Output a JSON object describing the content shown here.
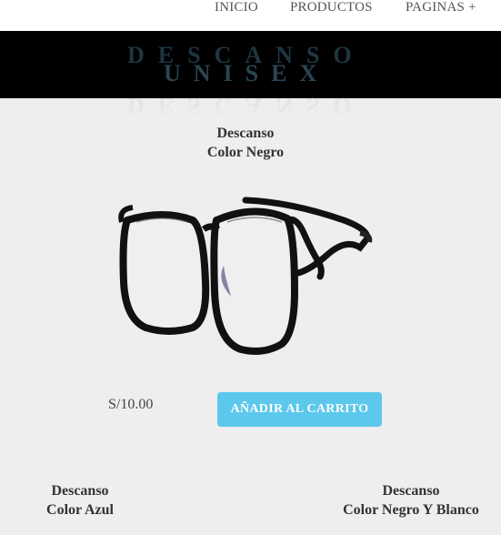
{
  "nav": {
    "items": [
      "INICIO",
      "PRODUCTOS",
      "PAGINAS +"
    ]
  },
  "banner": {
    "title": "DESCANSO",
    "subtitle": "UNISEX"
  },
  "featured_product": {
    "name_line1": "Descanso",
    "name_line2": "Color Negro",
    "price": "S/10.00",
    "add_to_cart_label": "AÑADIR AL CARRITO"
  },
  "more_products": [
    {
      "name_line1": "Descanso",
      "name_line2": "Color Azul"
    },
    {
      "name_line1": "Descanso",
      "name_line2": "Color Negro Y Blanco"
    }
  ],
  "colors": {
    "banner_bg": "#000000",
    "page_bg": "#eeeeee",
    "accent": "#5bc8ec"
  }
}
